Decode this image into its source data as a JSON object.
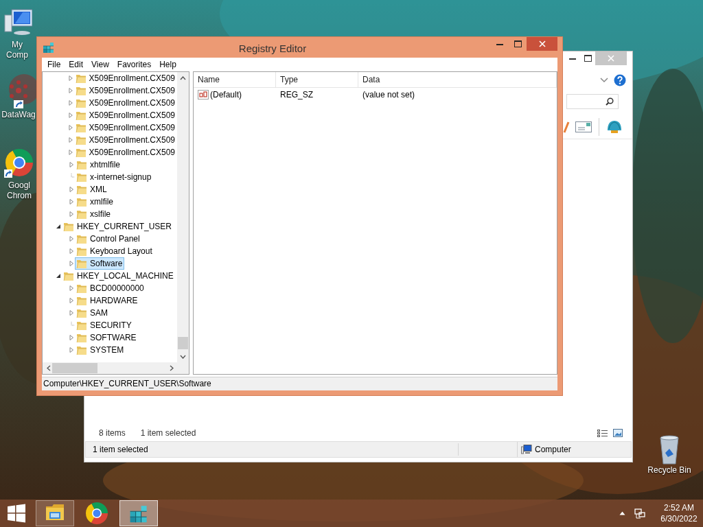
{
  "desktop_icons": [
    {
      "kind": "computer",
      "label": "My Comp"
    },
    {
      "kind": "datawag",
      "label": "DataWag"
    },
    {
      "kind": "chrome",
      "label": "Googl Chrom"
    },
    {
      "kind": "recycle-bin",
      "label": "Recycle Bin"
    }
  ],
  "explorer_window": {
    "details": {
      "count": "8 items",
      "selection": "1 item selected"
    },
    "status_bar": {
      "text": "1 item selected",
      "location": "Computer"
    }
  },
  "regedit_window": {
    "title": "Registry Editor",
    "menu": [
      "File",
      "Edit",
      "View",
      "Favorites",
      "Help"
    ],
    "tree": [
      {
        "children": [
          {
            "label": "X509Enrollment.CX509",
            "expanded": false,
            "expandable": true,
            "selected": false
          },
          {
            "label": "X509Enrollment.CX509",
            "expanded": false,
            "expandable": true,
            "selected": false
          },
          {
            "label": "X509Enrollment.CX509",
            "expanded": false,
            "expandable": true,
            "selected": false
          },
          {
            "label": "X509Enrollment.CX509",
            "expanded": false,
            "expandable": true,
            "selected": false
          },
          {
            "label": "X509Enrollment.CX509",
            "expanded": false,
            "expandable": true,
            "selected": false
          },
          {
            "label": "X509Enrollment.CX509",
            "expanded": false,
            "expandable": true,
            "selected": false
          },
          {
            "label": "X509Enrollment.CX509",
            "expanded": false,
            "expandable": true,
            "selected": false
          },
          {
            "label": "xhtmlfile",
            "expanded": false,
            "expandable": true,
            "selected": false
          },
          {
            "label": "x-internet-signup",
            "expanded": false,
            "expandable": false,
            "selected": false
          },
          {
            "label": "XML",
            "expanded": false,
            "expandable": true,
            "selected": false
          },
          {
            "label": "xmlfile",
            "expanded": false,
            "expandable": true,
            "selected": false
          },
          {
            "label": "xslfile",
            "expanded": false,
            "expandable": true,
            "selected": false
          }
        ]
      },
      {
        "label": "HKEY_CURRENT_USER",
        "expanded": true,
        "selected": false,
        "children": [
          {
            "label": "Control Panel",
            "expanded": false,
            "expandable": true,
            "selected": false
          },
          {
            "label": "Keyboard Layout",
            "expanded": false,
            "expandable": true,
            "selected": false
          },
          {
            "label": "Software",
            "expanded": false,
            "expandable": true,
            "selected": true
          }
        ]
      },
      {
        "label": "HKEY_LOCAL_MACHINE",
        "expanded": true,
        "selected": false,
        "children": [
          {
            "label": "BCD00000000",
            "expanded": false,
            "expandable": true,
            "selected": false
          },
          {
            "label": "HARDWARE",
            "expanded": false,
            "expandable": true,
            "selected": false
          },
          {
            "label": "SAM",
            "expanded": false,
            "expandable": true,
            "selected": false
          },
          {
            "label": "SECURITY",
            "expanded": false,
            "expandable": false,
            "selected": false
          },
          {
            "label": "SOFTWARE",
            "expanded": false,
            "expandable": true,
            "selected": false
          },
          {
            "label": "SYSTEM",
            "expanded": false,
            "expandable": true,
            "selected": false
          }
        ]
      }
    ],
    "columns": [
      "Name",
      "Type",
      "Data"
    ],
    "rows": [
      {
        "name": "(Default)",
        "type": "REG_SZ",
        "data": "(value not set)"
      }
    ],
    "status_bar": "Computer\\HKEY_CURRENT_USER\\Software"
  },
  "taskbar": {
    "apps": [
      {
        "kind": "explorer",
        "running": true,
        "selected": false
      },
      {
        "kind": "chrome",
        "running": false,
        "selected": false
      },
      {
        "kind": "regedit",
        "running": true,
        "selected": true
      }
    ],
    "time": "2:52 AM",
    "date": "6/30/2022"
  }
}
